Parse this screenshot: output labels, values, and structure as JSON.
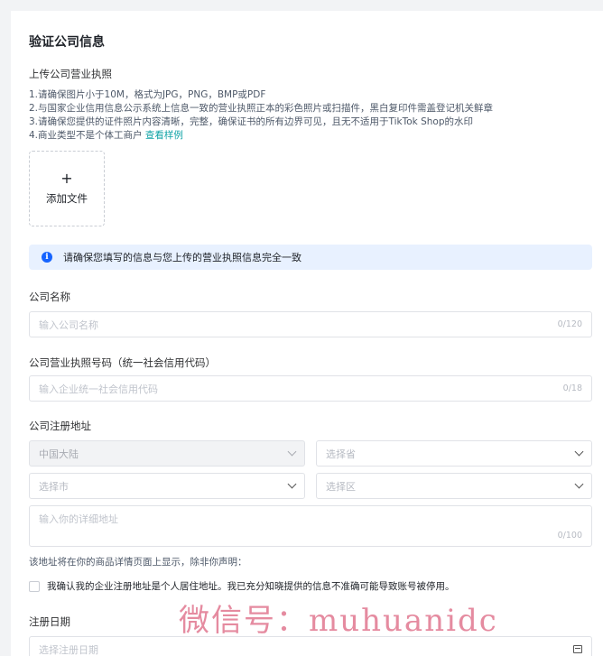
{
  "page_title": "验证公司信息",
  "license": {
    "label": "上传公司营业执照",
    "requirements": [
      "1.请确保图片小于10M，格式为JPG，PNG，BMP或PDF",
      "2.与国家企业信用信息公示系统上信息一致的营业执照正本的彩色照片或扫描件，黑白复印件需盖登记机关鲜章",
      "3.请确保您提供的证件照片内容清晰，完整，确保证书的所有边界可见，且无不适用于TikTok Shop的水印",
      "4.商业类型不是个体工商户"
    ],
    "example_link": "查看样例",
    "upload_plus": "+",
    "upload_label": "添加文件"
  },
  "notice": {
    "icon": "info-icon",
    "text": "请确保您填写的信息与您上传的营业执照信息完全一致"
  },
  "company_name": {
    "label": "公司名称",
    "placeholder": "输入公司名称",
    "counter": "0/120"
  },
  "license_number": {
    "label": "公司营业执照号码（统一社会信用代码）",
    "placeholder": "输入企业统一社会信用代码",
    "counter": "0/18"
  },
  "address": {
    "label": "公司注册地址",
    "country": "中国大陆",
    "province_placeholder": "选择省",
    "city_placeholder": "选择市",
    "district_placeholder": "选择区",
    "detail_placeholder": "输入你的详细地址",
    "detail_counter": "0/100",
    "hint": "该地址将在你的商品详情页面上显示，除非你声明：",
    "confirm_text": "我确认我的企业注册地址是个人居住地址。我已充分知晓提供的信息不准确可能导致账号被停用。"
  },
  "registration_date": {
    "label": "注册日期",
    "placeholder": "选择注册日期",
    "icon": "calendar-icon"
  },
  "watermark": "微信号：muhuanidc"
}
